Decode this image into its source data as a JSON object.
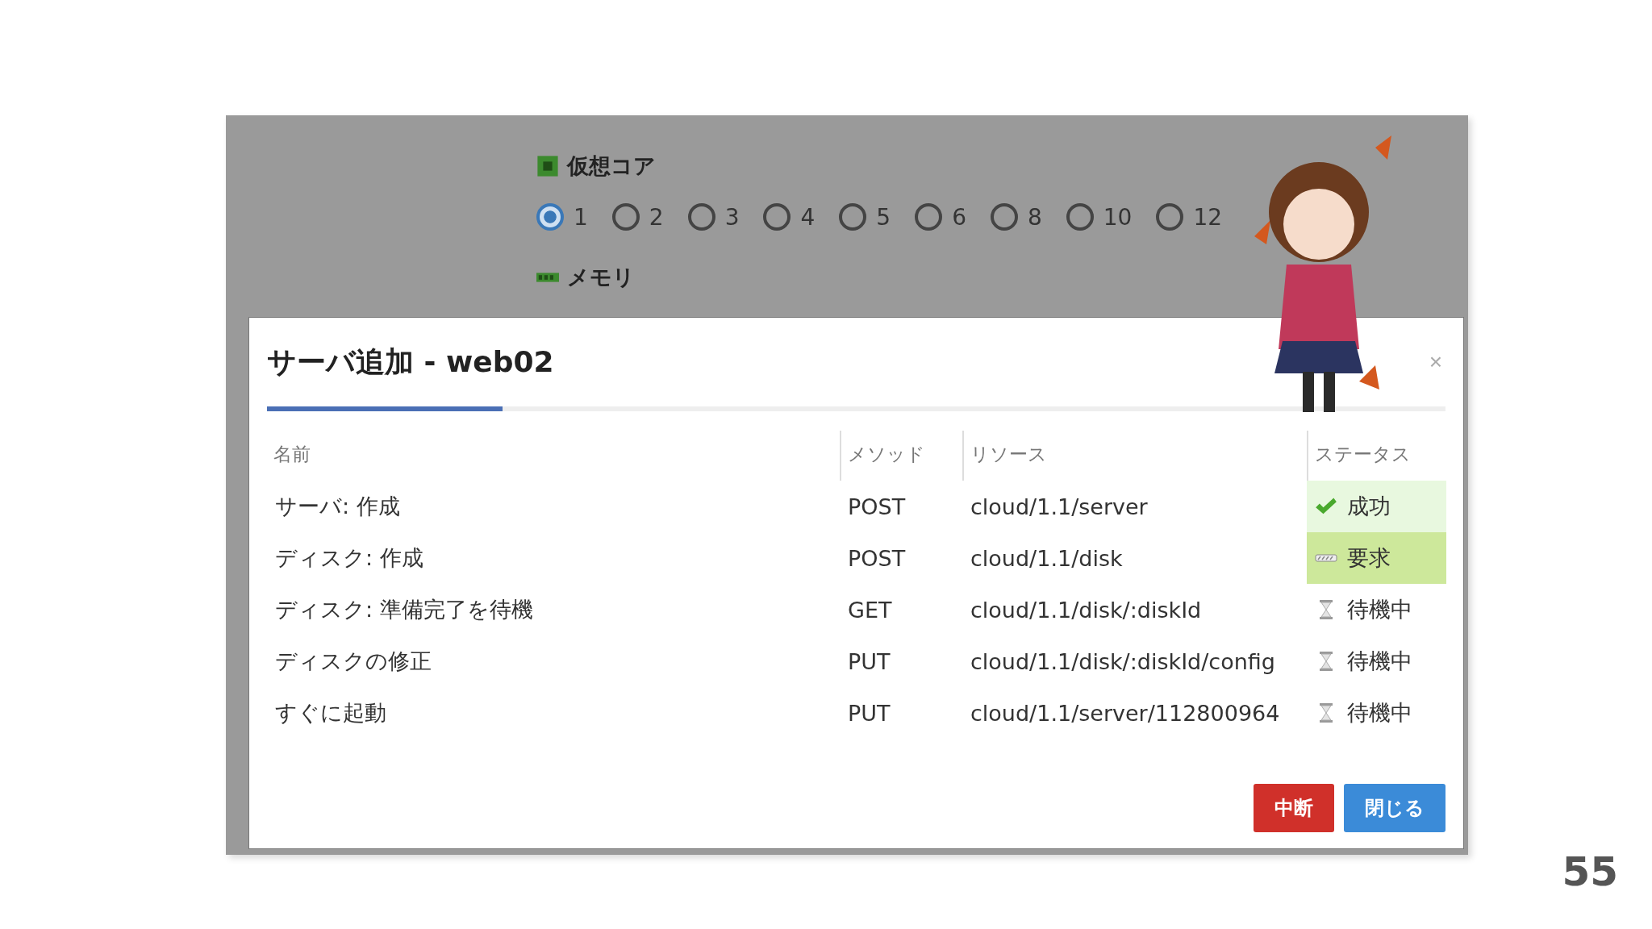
{
  "form": {
    "sections": [
      {
        "kind": "cpu",
        "label": "仮想コア",
        "options": [
          {
            "label": "1",
            "selected": true
          },
          {
            "label": "2",
            "selected": false
          },
          {
            "label": "3",
            "selected": false
          },
          {
            "label": "4",
            "selected": false
          },
          {
            "label": "5",
            "selected": false
          },
          {
            "label": "6",
            "selected": false
          },
          {
            "label": "8",
            "selected": false
          },
          {
            "label": "10",
            "selected": false
          },
          {
            "label": "12",
            "selected": false
          }
        ]
      },
      {
        "kind": "memory",
        "label": "メモリ"
      }
    ]
  },
  "dialog": {
    "title": "サーバ追加 - web02",
    "close": "×",
    "progress": {
      "level": 0.2
    },
    "columns": [
      "名前",
      "メソッド",
      "リソース",
      "ステータス"
    ],
    "rows": [
      {
        "name": "サーバ: 作成",
        "method": "POST",
        "resource": "cloud/1.1/server",
        "status": "成功",
        "kind": "success"
      },
      {
        "name": "ディスク: 作成",
        "method": "POST",
        "resource": "cloud/1.1/disk",
        "status": "要求",
        "kind": "request"
      },
      {
        "name": "ディスク: 準備完了を待機",
        "method": "GET",
        "resource": "cloud/1.1/disk/:diskId",
        "status": "待機中",
        "kind": "waiting"
      },
      {
        "name": "ディスクの修正",
        "method": "PUT",
        "resource": "cloud/1.1/disk/:diskId/config",
        "status": "待機中",
        "kind": "waiting"
      },
      {
        "name": "すぐに起動",
        "method": "PUT",
        "resource": "cloud/1.1/server/112800964",
        "status": "待機中",
        "kind": "waiting"
      }
    ],
    "buttons": [
      {
        "label": "中断",
        "kind": "danger"
      },
      {
        "label": "閉じる",
        "kind": "primary"
      }
    ]
  },
  "page_number": "55"
}
